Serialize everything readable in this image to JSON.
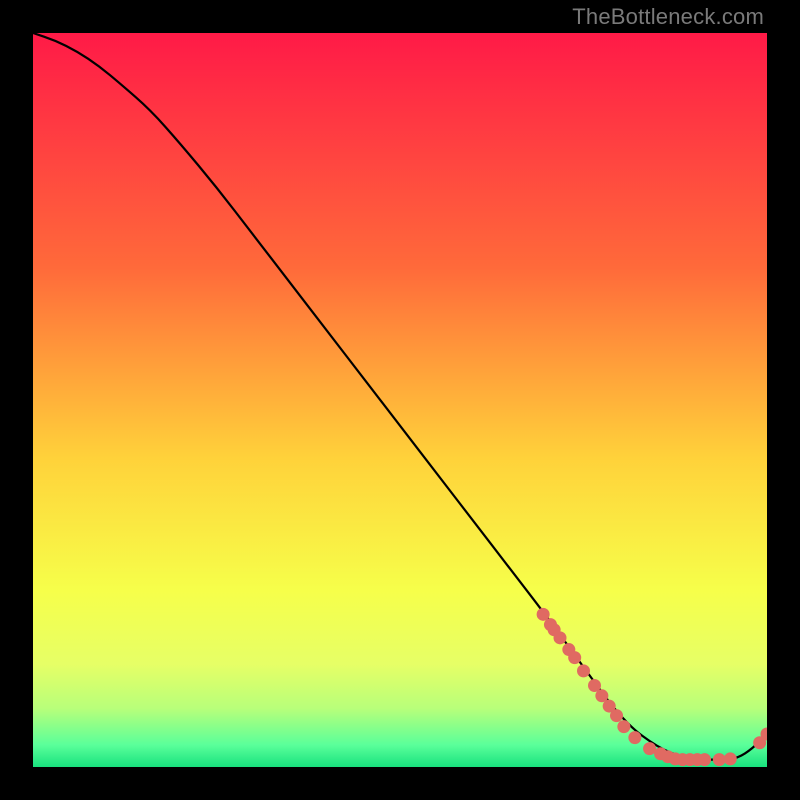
{
  "watermark": "TheBottleneck.com",
  "colors": {
    "gradient_top": "#ff1a47",
    "gradient_upper_mid": "#ff6a3a",
    "gradient_mid": "#ffd23a",
    "gradient_lower_mid": "#f6ff4a",
    "gradient_band1": "#e6ff66",
    "gradient_band2": "#b8ff7a",
    "gradient_band3": "#5aff9a",
    "gradient_bottom": "#18e27e",
    "curve": "#000000",
    "marker": "#e06a62"
  },
  "chart_data": {
    "type": "line",
    "title": "",
    "xlabel": "",
    "ylabel": "",
    "xlim": [
      0,
      100
    ],
    "ylim": [
      0,
      100
    ],
    "curve": {
      "x": [
        0,
        3,
        6,
        9,
        12,
        16,
        20,
        25,
        30,
        35,
        40,
        45,
        50,
        55,
        60,
        65,
        70,
        74,
        78,
        80,
        82,
        84,
        86,
        88,
        90,
        92,
        94,
        96,
        98,
        100
      ],
      "y": [
        100,
        99,
        97.5,
        95.5,
        93,
        89.5,
        85,
        79,
        72.5,
        66,
        59.5,
        53,
        46.5,
        40,
        33.5,
        27,
        20.5,
        15,
        9.5,
        7,
        5,
        3.5,
        2.3,
        1.5,
        1,
        1,
        1,
        1.2,
        2.5,
        4.5
      ]
    },
    "markers": [
      {
        "x": 69.5,
        "y": 20.8
      },
      {
        "x": 70.5,
        "y": 19.4
      },
      {
        "x": 71.0,
        "y": 18.7
      },
      {
        "x": 71.8,
        "y": 17.6
      },
      {
        "x": 73.0,
        "y": 16.0
      },
      {
        "x": 73.8,
        "y": 14.9
      },
      {
        "x": 75.0,
        "y": 13.1
      },
      {
        "x": 76.5,
        "y": 11.1
      },
      {
        "x": 77.5,
        "y": 9.7
      },
      {
        "x": 78.5,
        "y": 8.3
      },
      {
        "x": 79.5,
        "y": 7.0
      },
      {
        "x": 80.5,
        "y": 5.5
      },
      {
        "x": 82.0,
        "y": 4.0
      },
      {
        "x": 84.0,
        "y": 2.5
      },
      {
        "x": 85.5,
        "y": 1.8
      },
      {
        "x": 86.5,
        "y": 1.4
      },
      {
        "x": 87.5,
        "y": 1.1
      },
      {
        "x": 88.5,
        "y": 1.0
      },
      {
        "x": 89.5,
        "y": 1.0
      },
      {
        "x": 90.5,
        "y": 1.0
      },
      {
        "x": 91.5,
        "y": 1.0
      },
      {
        "x": 93.5,
        "y": 1.0
      },
      {
        "x": 95.0,
        "y": 1.1
      },
      {
        "x": 99.0,
        "y": 3.3
      },
      {
        "x": 100.0,
        "y": 4.5
      }
    ]
  }
}
